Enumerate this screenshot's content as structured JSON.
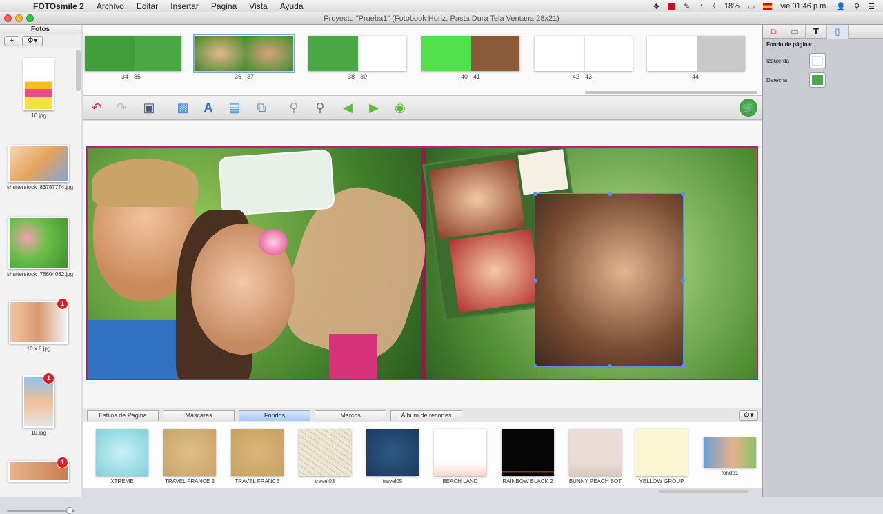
{
  "menubar": {
    "app_name": "FOTOsmile 2",
    "menus": [
      "Archivo",
      "Editar",
      "Insertar",
      "Página",
      "Vista",
      "Ayuda"
    ],
    "battery": "18%",
    "clock": "vie 01:46 p.m."
  },
  "window": {
    "title": "Proyecto \"Prueba1\" (Fotobook Horiz. Pasta Dura Tela Ventana 28x21)"
  },
  "photos_panel": {
    "title": "Fotos",
    "add_label": "+",
    "gear_label": "⚙▾",
    "items": [
      {
        "name": "16.jpg",
        "badge": ""
      },
      {
        "name": "shutterstock_83787774.jpg",
        "badge": ""
      },
      {
        "name": "shutterstock_76604082.jpg",
        "badge": ""
      },
      {
        "name": "10 x 8.jpg",
        "badge": "1"
      },
      {
        "name": "10.jpg",
        "badge": "1"
      },
      {
        "name": "",
        "badge": "1"
      }
    ]
  },
  "pages_strip": {
    "items": [
      {
        "label": "34 - 35"
      },
      {
        "label": "36 - 37"
      },
      {
        "label": "38 - 39"
      },
      {
        "label": "40 - 41"
      },
      {
        "label": "42 - 43"
      },
      {
        "label": "44"
      }
    ]
  },
  "toolbar": {
    "icons": [
      "undo-icon",
      "redo-icon",
      "save-icon",
      "add-photo-icon",
      "add-text-icon",
      "add-clipart-icon",
      "replace-photo-icon",
      "zoom-out-icon",
      "zoom-in-icon",
      "prev-page-icon",
      "next-page-icon",
      "play-icon",
      "cart-icon"
    ]
  },
  "bottom_tabs": {
    "items": [
      "Estilos de Página",
      "Máscaras",
      "Fondos",
      "Marcos",
      "Álbum de recortes"
    ],
    "active": "Fondos"
  },
  "backgrounds": {
    "items": [
      {
        "name": "XTREME",
        "color": "#7fd0dc"
      },
      {
        "name": "TRAVEL FRANCE 2",
        "color": "#c9a46a"
      },
      {
        "name": "TRAVEL FRANCE",
        "color": "#c8a063"
      },
      {
        "name": "travel03",
        "color": "#ece6d2"
      },
      {
        "name": "travel05",
        "color": "#1c3a5e"
      },
      {
        "name": "BEACH LAND",
        "color": "#ffffff"
      },
      {
        "name": "RAINBOW BLACK 2",
        "color": "#050505"
      },
      {
        "name": "BUNNY PEACH BOT",
        "color": "#e9ddd6"
      },
      {
        "name": "YELLOW GROUP",
        "color": "#fbf6d2"
      },
      {
        "name": "fondo1",
        "color": "#6aa0d6"
      }
    ]
  },
  "inspector": {
    "heading": "Fondo de página:",
    "left_label": "Izquierda",
    "right_label": "Derecha",
    "left_color": "#ffffff",
    "right_color": "#4aa84a"
  }
}
